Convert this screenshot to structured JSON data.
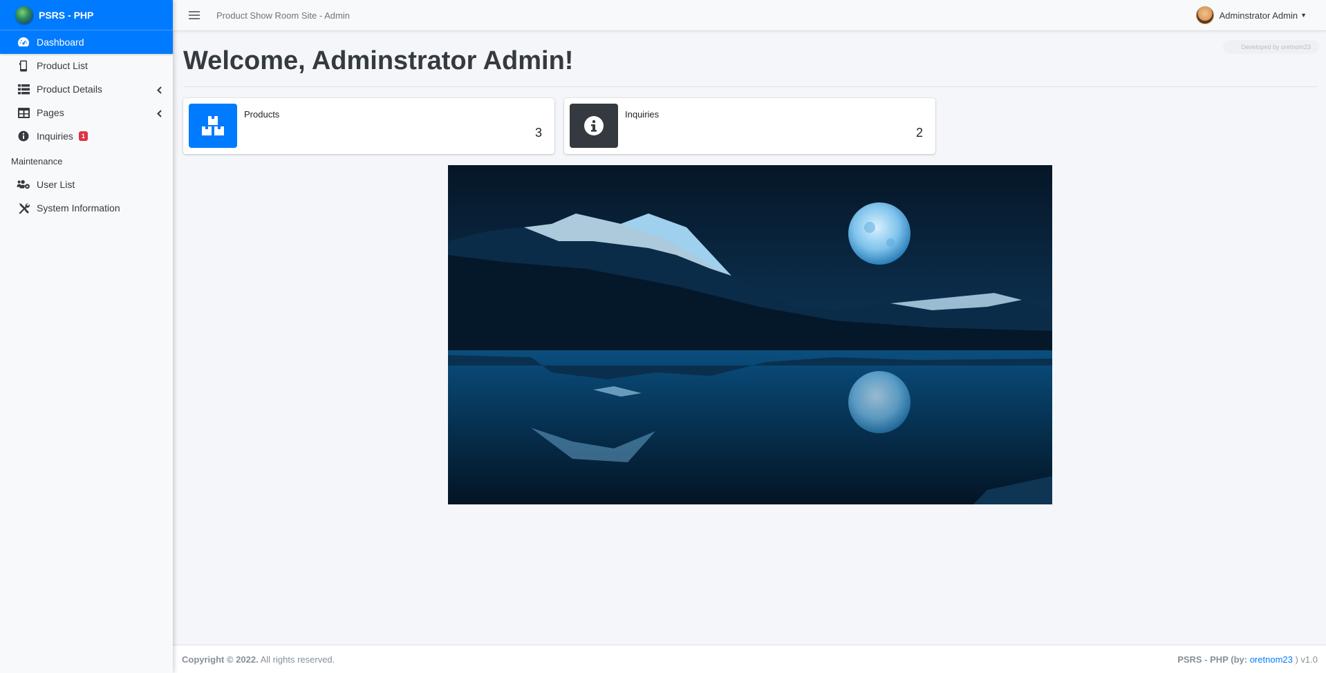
{
  "brand": {
    "name": "PSRS - PHP"
  },
  "topbar": {
    "site_title": "Product Show Room Site - Admin",
    "user_name": "Adminstrator Admin",
    "dev_credit": "Developed by oretnom23"
  },
  "sidebar": {
    "items": [
      {
        "label": "Dashboard",
        "icon": "dashboard-icon",
        "active": true
      },
      {
        "label": "Product List",
        "icon": "mobile-icon"
      },
      {
        "label": "Product Details",
        "icon": "list-icon",
        "caret": true
      },
      {
        "label": "Pages",
        "icon": "table-icon",
        "caret": true
      },
      {
        "label": "Inquiries",
        "icon": "info-icon",
        "badge": "1"
      }
    ],
    "section_header": "Maintenance",
    "maintenance_items": [
      {
        "label": "User List",
        "icon": "users-cog-icon"
      },
      {
        "label": "System Information",
        "icon": "tools-icon"
      }
    ]
  },
  "main": {
    "title": "Welcome, Adminstrator Admin!",
    "cards": [
      {
        "label": "Products",
        "value": "3",
        "color": "#007bff",
        "icon": "boxes-icon"
      },
      {
        "label": "Inquiries",
        "value": "2",
        "color": "#343a40",
        "icon": "info-circle-icon"
      }
    ]
  },
  "footer": {
    "copyright": "Copyright © 2022.",
    "rights": "All rights reserved.",
    "app_prefix": "PSRS - PHP (by:",
    "author_link": "oretnom23",
    "version": ") v1.0"
  },
  "colors": {
    "primary": "#007bff",
    "dark": "#343a40",
    "danger": "#dc3545"
  }
}
